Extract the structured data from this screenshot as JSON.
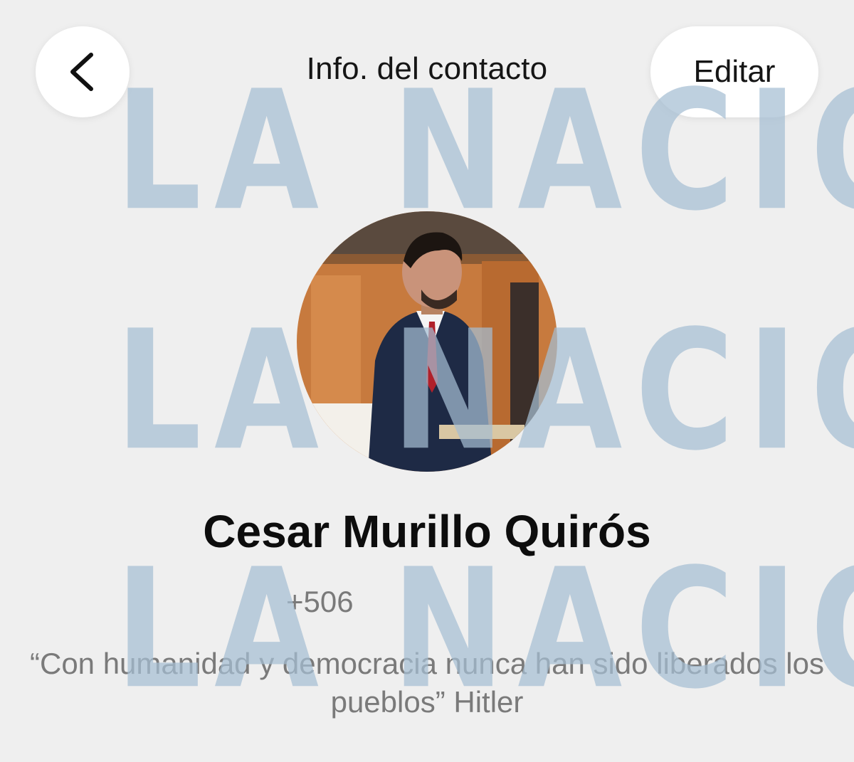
{
  "header": {
    "title": "Info. del contacto",
    "edit_label": "Editar",
    "back_icon": "chevron-left-icon"
  },
  "contact": {
    "name": "Cesar Murillo Quirós",
    "phone": "+506",
    "status": "“Con humanidad y democracia nunca han sido liberados los pueblos” Hitler"
  },
  "watermark": {
    "text": "LA NACIÓN"
  },
  "colors": {
    "background": "#efefef",
    "button_background": "#ffffff",
    "secondary_text": "#7a7a7a",
    "watermark": "#a5bed2"
  }
}
